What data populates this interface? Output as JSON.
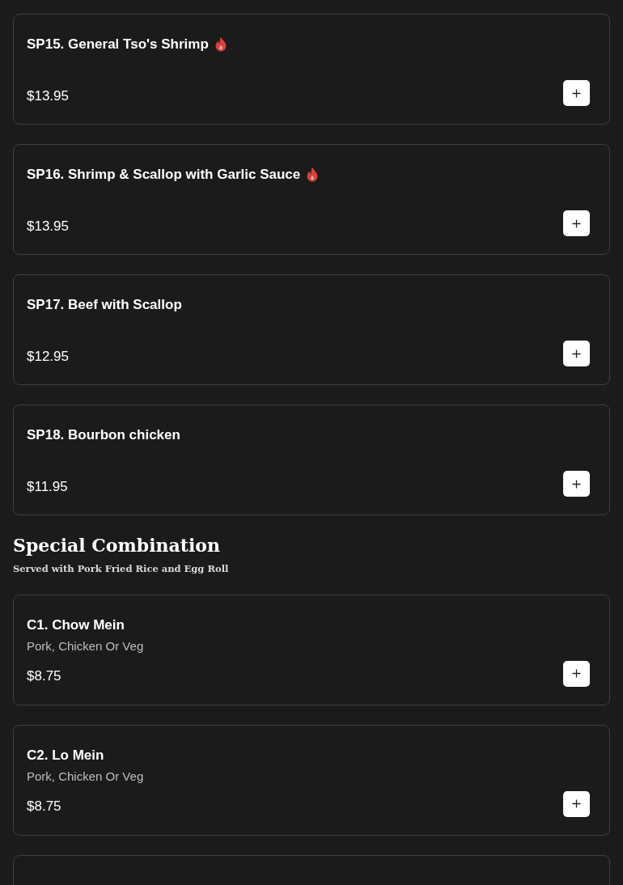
{
  "sections": [
    {
      "items": [
        {
          "kind": "dish",
          "name": "SP15. General Tso's Shrimp",
          "spicy": true,
          "price": "$13.95"
        },
        {
          "kind": "dish",
          "name": "SP16. Shrimp & Scallop with Garlic Sauce",
          "spicy": true,
          "price": "$13.95"
        },
        {
          "kind": "dish",
          "name": "SP17. Beef with Scallop",
          "spicy": false,
          "price": "$12.95"
        },
        {
          "kind": "dish",
          "name": "SP18. Bourbon chicken",
          "spicy": false,
          "price": "$11.95"
        }
      ]
    },
    {
      "title": "Special Combination",
      "subtitle": "Served with Pork Fried Rice and Egg Roll",
      "items": [
        {
          "kind": "dish",
          "name": "C1. Chow Mein",
          "description": "Pork, Chicken Or Veg",
          "spicy": false,
          "price": "$8.75"
        },
        {
          "kind": "dish",
          "name": "C2. Lo Mein",
          "description": "Pork, Chicken Or Veg",
          "spicy": false,
          "price": "$8.75"
        },
        {
          "kind": "cut_off"
        }
      ]
    }
  ]
}
